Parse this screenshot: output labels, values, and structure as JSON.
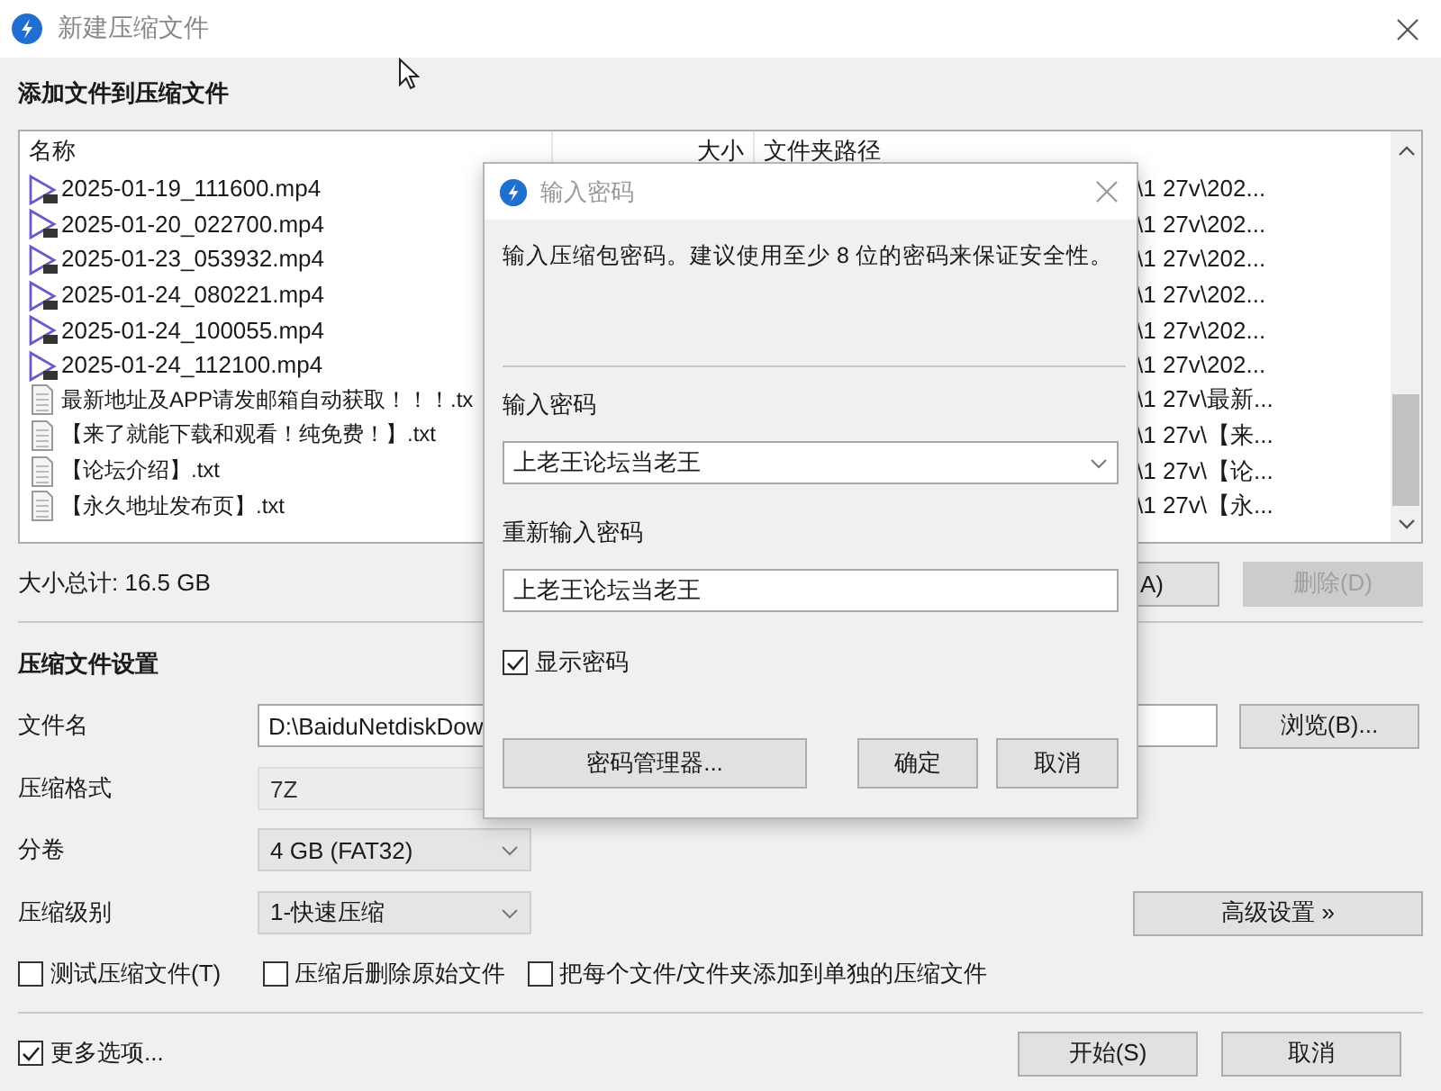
{
  "window": {
    "title": "新建压缩文件"
  },
  "files_heading": "添加文件到压缩文件",
  "file_list": {
    "columns": [
      "名称",
      "大小",
      "文件夹路径"
    ],
    "rows": [
      {
        "kind": "video",
        "name": "2025-01-19_111600.mp4",
        "path": "\\1 27v\\202..."
      },
      {
        "kind": "video",
        "name": "2025-01-20_022700.mp4",
        "path": "\\1 27v\\202..."
      },
      {
        "kind": "video",
        "name": "2025-01-23_053932.mp4",
        "path": "\\1 27v\\202..."
      },
      {
        "kind": "video",
        "name": "2025-01-24_080221.mp4",
        "path": "\\1 27v\\202..."
      },
      {
        "kind": "video",
        "name": "2025-01-24_100055.mp4",
        "path": "\\1 27v\\202..."
      },
      {
        "kind": "video",
        "name": "2025-01-24_112100.mp4",
        "path": "\\1 27v\\202..."
      },
      {
        "kind": "text",
        "name": "最新地址及APP请发邮箱自动获取！！！.tx",
        "path": "\\1 27v\\最新..."
      },
      {
        "kind": "text",
        "name": "【来了就能下载和观看！纯免费！】.txt",
        "path": "\\1 27v\\【来..."
      },
      {
        "kind": "text",
        "name": "【论坛介绍】.txt",
        "path": "\\1 27v\\【论..."
      },
      {
        "kind": "text",
        "name": "【永久地址发布页】.txt",
        "path": "\\1 27v\\【永..."
      }
    ]
  },
  "total_size": "大小总计: 16.5 GB",
  "list_buttons": [
    {
      "label": "A)",
      "disabled": false
    },
    {
      "label": "删除(D)",
      "disabled": true
    }
  ],
  "settings": {
    "heading": "压缩文件设置",
    "filename": {
      "label": "文件名",
      "value": "D:\\BaiduNetdiskDow"
    },
    "browse_button": "浏览(B)...",
    "format": {
      "label": "压缩格式",
      "value": "7Z",
      "disabled": true
    },
    "split": {
      "label": "分卷",
      "value": "4 GB (FAT32)"
    },
    "level": {
      "label": "压缩级别",
      "value": "1-快速压缩"
    },
    "advanced_button": "高级设置 »"
  },
  "options": [
    {
      "label": "测试压缩文件(T)",
      "checked": false
    },
    {
      "label": "压缩后删除原始文件",
      "checked": false
    },
    {
      "label": "把每个文件/文件夹添加到单独的压缩文件",
      "checked": false
    }
  ],
  "more_options": {
    "label": "更多选项...",
    "checked": true
  },
  "footer_buttons": [
    "开始(S)",
    "取消"
  ],
  "password_dialog": {
    "title": "输入密码",
    "message": "输入压缩包密码。建议使用至少 8 位的密码来保证安全性。",
    "password_label": "输入密码",
    "password": "上老王论坛当老王",
    "confirm_label": "重新输入密码",
    "confirm": "上老王论坛当老王",
    "show_password": {
      "label": "显示密码",
      "checked": true
    },
    "buttons": [
      "密码管理器...",
      "确定",
      "取消"
    ]
  }
}
